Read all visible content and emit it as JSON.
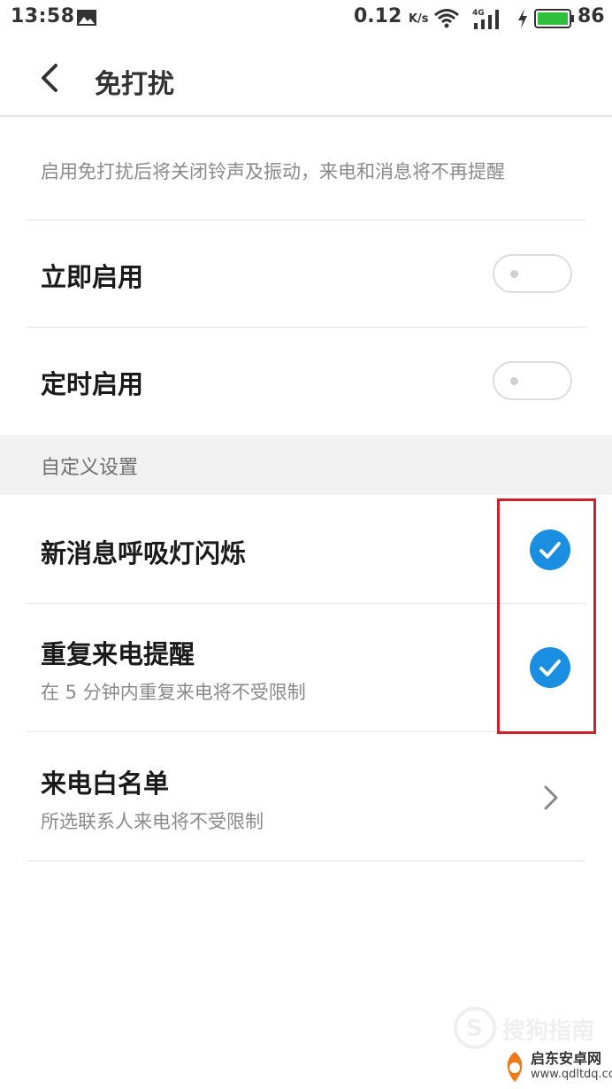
{
  "status_bar": {
    "time": "13:58",
    "speed": "0.12",
    "speed_unit": "K/s",
    "network": "4G",
    "battery": "86",
    "colors": {
      "battery_fill": "#2ebf3c"
    },
    "icons": [
      "image-icon",
      "wifi-icon",
      "signal-icon",
      "charging-icon",
      "battery-icon"
    ]
  },
  "header": {
    "title": "免打扰",
    "back_icon": "chevron-left-icon"
  },
  "description": "启用免打扰后将关闭铃声及振动，来电和消息将不再提醒",
  "toggles": [
    {
      "label": "立即启用",
      "on": false
    },
    {
      "label": "定时启用",
      "on": false
    }
  ],
  "custom_section": {
    "title": "自定义设置",
    "items": [
      {
        "label": "新消息呼吸灯闪烁",
        "checked": true
      },
      {
        "label": "重复来电提醒",
        "sub": "在 5 分钟内重复来电将不受限制",
        "checked": true
      }
    ]
  },
  "whitelist": {
    "label": "来电白名单",
    "sub": "所选联系人来电将不受限制",
    "icon": "chevron-right-icon"
  },
  "accent_color": "#1a8ee0",
  "annotation_color": "#d0202c",
  "watermarks": {
    "sogou": "搜狗指南",
    "brand": "启东安卓网",
    "url": "www.qdltdq.com"
  }
}
